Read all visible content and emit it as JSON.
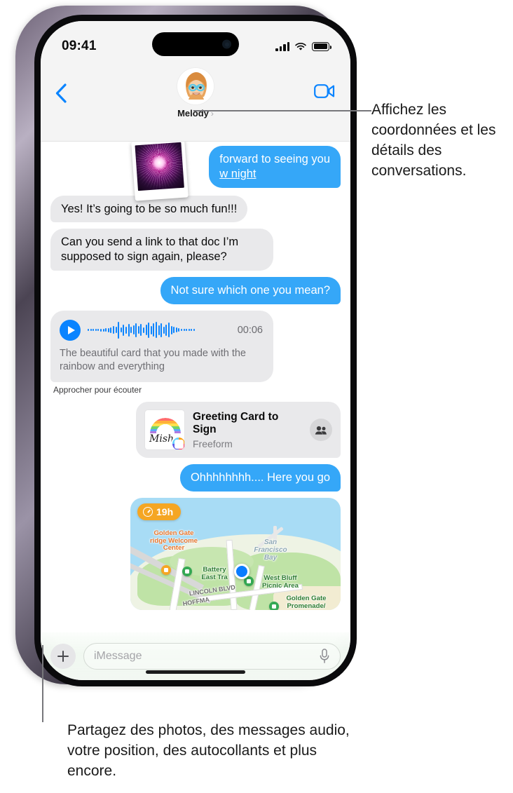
{
  "status_bar": {
    "time": "09:41",
    "cellular_icon": "signal-bars-icon",
    "wifi_icon": "wifi-icon",
    "battery_icon": "battery-icon"
  },
  "nav": {
    "back_icon": "back-chevron-icon",
    "contact_name": "Melody",
    "contact_chevron": "›",
    "avatar_icon": "memoji-avatar",
    "facetime_icon": "video-camera-icon"
  },
  "messages": [
    {
      "id": "msg-1",
      "side": "outgoing",
      "type": "text-with-photo",
      "text_visible": "forward to seeing you",
      "text_link": "w night",
      "photo_icon": "fireworks-photo-thumbnail"
    },
    {
      "id": "msg-2",
      "side": "incoming",
      "type": "text",
      "text": "Yes! It’s going to be so much fun!!!"
    },
    {
      "id": "msg-3",
      "side": "incoming",
      "type": "text",
      "text": "Can you send a link to that doc I’m supposed to sign again, please?"
    },
    {
      "id": "msg-4",
      "side": "outgoing",
      "type": "text",
      "text": "Not sure which one you mean?"
    },
    {
      "id": "msg-5",
      "side": "incoming",
      "type": "audio",
      "play_icon": "play-icon",
      "duration": "00:06",
      "transcript": "The beautiful card that you made with the rainbow and everything",
      "caption": "Approcher pour écouter"
    },
    {
      "id": "msg-6",
      "side": "outgoing",
      "type": "app-card",
      "title": "Greeting Card to Sign",
      "subtitle": "Freeform",
      "thumb_icon": "freeform-rainbow-thumbnail",
      "app_badge_icon": "freeform-app-badge",
      "people_icon": "shared-with-you-people-icon",
      "thumb_script_text": "Mish"
    },
    {
      "id": "msg-7",
      "side": "outgoing",
      "type": "text",
      "text": "Ohhhhhhhh.... Here you go"
    },
    {
      "id": "msg-8",
      "side": "outgoing",
      "type": "map",
      "timer_icon": "clock-icon",
      "timer_label": "19h",
      "labels": [
        "Golden Gate",
        "ridge Welcome",
        "Center",
        "Battery",
        "East Tra",
        "West Bluff",
        "Picnic Area",
        "Golden Gate",
        "Promenade/",
        "San",
        "Francisco",
        "Bay",
        "LINCOLN BLVD",
        "HOFFMA"
      ]
    }
  ],
  "input_bar": {
    "plus_icon": "plus-icon",
    "placeholder": "iMessage",
    "mic_icon": "microphone-icon"
  },
  "callouts": {
    "top": "Affichez les coordonnées et les détails des conversations.",
    "bottom": "Partagez des photos, des messages audio, votre position, des autocollants et plus encore."
  },
  "colors": {
    "outgoing_bubble": "#35a7f8",
    "incoming_bubble": "#e9e9eb",
    "accent_blue": "#0a84ff",
    "timer_orange": "#f5a623",
    "chrome_gray": "#f4f4f4"
  }
}
